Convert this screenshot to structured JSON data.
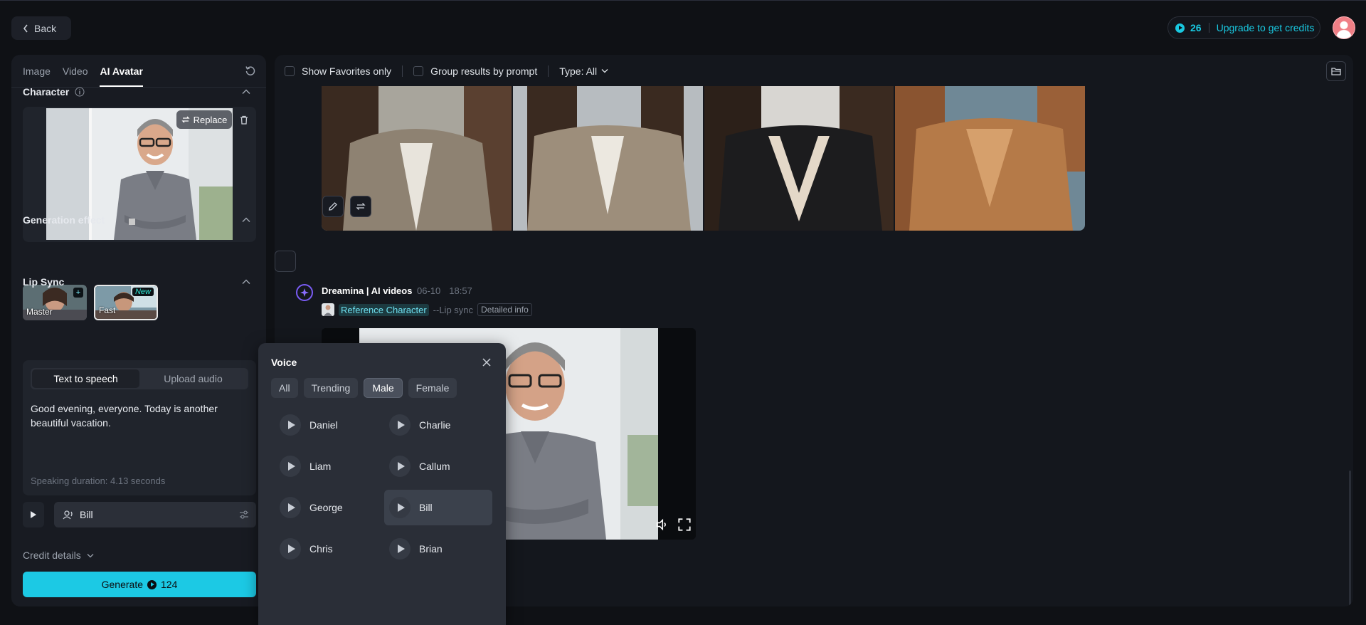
{
  "header": {
    "back_label": "Back",
    "credits": "26",
    "upgrade_label": "Upgrade to get credits"
  },
  "left": {
    "tabs": [
      {
        "label": "Image"
      },
      {
        "label": "Video"
      },
      {
        "label": "AI Avatar"
      }
    ],
    "character_title": "Character",
    "replace_label": "Replace",
    "generation_effect_title": "Generation effect",
    "effects": [
      {
        "label": "Master"
      },
      {
        "label": "Fast",
        "badge": "New"
      }
    ],
    "lip_sync_title": "Lip Sync",
    "lip_tabs": [
      "Text to speech",
      "Upload audio"
    ],
    "lip_text": "Good evening, everyone. Today is another beautiful vacation.",
    "speaking_duration": "Speaking duration: 4.13 seconds",
    "voice_selected": "Bill",
    "credit_details_label": "Credit details",
    "generate_label": "Generate",
    "generate_cost": "124"
  },
  "right": {
    "filters": {
      "favorites": "Show Favorites only",
      "group": "Group results by prompt",
      "type": "Type: All"
    },
    "entry": {
      "title": "Dreamina | AI videos",
      "date": "06-10",
      "time": "18:57",
      "reference_label": "Reference Character",
      "mode": "--Lip sync",
      "detail_label": "Detailed info"
    }
  },
  "voice_popup": {
    "title": "Voice",
    "filters": [
      "All",
      "Trending",
      "Male",
      "Female"
    ],
    "active_filter": "Male",
    "voices": [
      {
        "name": "Daniel"
      },
      {
        "name": "Charlie"
      },
      {
        "name": "Liam"
      },
      {
        "name": "Callum"
      },
      {
        "name": "George"
      },
      {
        "name": "Bill",
        "selected": true
      },
      {
        "name": "Chris"
      },
      {
        "name": "Brian"
      }
    ]
  },
  "colors": {
    "accent": "#1cc9e4",
    "background": "#0f1115",
    "panel": "#181b22"
  }
}
